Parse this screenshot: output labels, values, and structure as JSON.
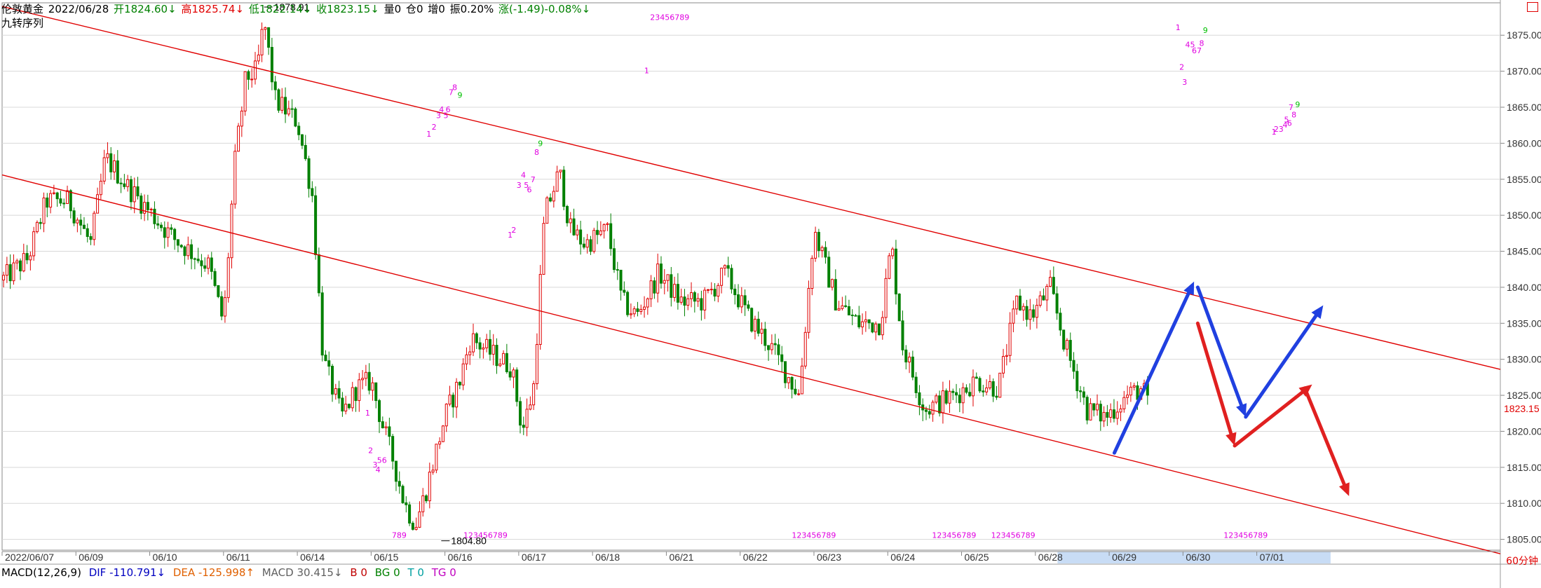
{
  "header": {
    "symbol": "伦敦黄金",
    "date": "2022/06/28",
    "open": "开1824.60↓",
    "high": "高1825.74↓",
    "low": "低1822.14↓",
    "close": "收1823.15↓",
    "volume": "量0",
    "position": "仓0",
    "increase": "增0",
    "amplitude": "振0.20%",
    "change": "涨(-1.49)-0.08%↓"
  },
  "indicator_title": "九转序列",
  "macd": {
    "name": "MACD(12,26,9)",
    "dif": "DIF -110.791↓",
    "dea": "DEA -125.998↑",
    "macd": "MACD 30.415↓",
    "b": "B 0",
    "bg": "BG 0",
    "t": "T 0",
    "tg": "TG 0"
  },
  "period_label": "60分钟",
  "current_price_label": "1823.15",
  "colors": {
    "up": "#e00000",
    "down": "#008000",
    "trendline": "#e00000",
    "arrow_blue": "#2040e0",
    "arrow_red": "#e02020",
    "seq": "#e000e0",
    "seq_green": "#00c000",
    "axis_hl": "#c8dcf5"
  },
  "chart_data": {
    "type": "candlestick",
    "y_axis": {
      "min": 1803.5,
      "max": 1879.5,
      "ticks": [
        1805,
        1810,
        1815,
        1820,
        1825,
        1830,
        1835,
        1840,
        1845,
        1850,
        1855,
        1860,
        1865,
        1870,
        1875
      ],
      "tick_labels": [
        "1805.00",
        "1810.00",
        "1815.00",
        "1820.00",
        "1825.00",
        "1830.00",
        "1835.00",
        "1840.00",
        "1845.00",
        "1850.00",
        "1855.00",
        "1860.00",
        "1865.00",
        "1870.00",
        "1875.00"
      ],
      "position": "right"
    },
    "x_axis": {
      "start": 0,
      "end": 20.3,
      "labels": [
        {
          "x": 0,
          "text": "2022/06/07"
        },
        {
          "x": 1,
          "text": "06/09"
        },
        {
          "x": 2,
          "text": "06/10"
        },
        {
          "x": 3,
          "text": "06/11"
        },
        {
          "x": 4,
          "text": "06/14"
        },
        {
          "x": 5,
          "text": "06/15"
        },
        {
          "x": 6,
          "text": "06/16"
        },
        {
          "x": 7,
          "text": "06/17"
        },
        {
          "x": 8,
          "text": "06/18"
        },
        {
          "x": 9,
          "text": "06/21"
        },
        {
          "x": 10,
          "text": "06/22"
        },
        {
          "x": 11,
          "text": "06/23"
        },
        {
          "x": 12,
          "text": "06/24"
        },
        {
          "x": 13,
          "text": "06/25"
        },
        {
          "x": 14,
          "text": "06/28"
        },
        {
          "x": 15,
          "text": "06/29"
        },
        {
          "x": 16,
          "text": "06/30"
        },
        {
          "x": 17,
          "text": "07/01"
        }
      ],
      "highlight": [
        14.3,
        18.0
      ]
    },
    "grid": true,
    "anchors": [
      [
        0.0,
        1841
      ],
      [
        0.35,
        1844
      ],
      [
        0.6,
        1852
      ],
      [
        0.9,
        1852
      ],
      [
        1.2,
        1846
      ],
      [
        1.4,
        1858
      ],
      [
        1.7,
        1854
      ],
      [
        2.3,
        1847
      ],
      [
        2.8,
        1843
      ],
      [
        3.0,
        1835
      ],
      [
        3.15,
        1857
      ],
      [
        3.3,
        1869
      ],
      [
        3.45,
        1870
      ],
      [
        3.55,
        1877
      ],
      [
        3.7,
        1866
      ],
      [
        4.0,
        1863
      ],
      [
        4.2,
        1853
      ],
      [
        4.35,
        1830
      ],
      [
        4.6,
        1822
      ],
      [
        4.8,
        1826
      ],
      [
        5.0,
        1827
      ],
      [
        5.15,
        1821
      ],
      [
        5.3,
        1816
      ],
      [
        5.45,
        1810
      ],
      [
        5.6,
        1807
      ],
      [
        5.75,
        1812
      ],
      [
        6.0,
        1822
      ],
      [
        6.2,
        1827
      ],
      [
        6.35,
        1833
      ],
      [
        6.6,
        1831
      ],
      [
        6.9,
        1829
      ],
      [
        7.05,
        1820
      ],
      [
        7.2,
        1826
      ],
      [
        7.35,
        1850
      ],
      [
        7.55,
        1856
      ],
      [
        7.7,
        1848
      ],
      [
        7.9,
        1846
      ],
      [
        8.2,
        1848
      ],
      [
        8.4,
        1838
      ],
      [
        8.6,
        1836
      ],
      [
        8.9,
        1842
      ],
      [
        9.2,
        1838
      ],
      [
        9.5,
        1838
      ],
      [
        9.8,
        1842
      ],
      [
        10.1,
        1836
      ],
      [
        10.4,
        1832
      ],
      [
        10.8,
        1825
      ],
      [
        11.0,
        1848
      ],
      [
        11.3,
        1838
      ],
      [
        11.6,
        1835
      ],
      [
        11.9,
        1835
      ],
      [
        12.05,
        1846
      ],
      [
        12.2,
        1832
      ],
      [
        12.5,
        1823
      ],
      [
        12.9,
        1825
      ],
      [
        13.2,
        1827
      ],
      [
        13.5,
        1826
      ],
      [
        13.75,
        1838
      ],
      [
        13.95,
        1836
      ],
      [
        14.2,
        1840
      ],
      [
        14.4,
        1832
      ],
      [
        14.7,
        1823
      ],
      [
        14.95,
        1822
      ],
      [
        15.25,
        1825
      ],
      [
        15.45,
        1826
      ],
      [
        15.55,
        1823
      ]
    ],
    "annotations": [
      {
        "x": 3.55,
        "y": 1878.91,
        "text": "1878.91",
        "type": "high"
      },
      {
        "x": 5.95,
        "y": 1804.8,
        "text": "1804.80",
        "type": "low"
      }
    ],
    "trendlines": [
      {
        "from": [
          0.0,
          1879.0
        ],
        "to": [
          20.3,
          1828.6
        ]
      },
      {
        "from": [
          0.0,
          1855.6
        ],
        "to": [
          20.3,
          1803.0
        ]
      }
    ],
    "arrows": [
      {
        "color": "blue",
        "from": [
          15.07,
          1817.0
        ],
        "to": [
          16.15,
          1840.8
        ]
      },
      {
        "color": "blue",
        "from": [
          16.2,
          1840.0
        ],
        "to": [
          16.85,
          1822.0
        ]
      },
      {
        "color": "blue",
        "from": [
          16.85,
          1822.0
        ],
        "to": [
          17.9,
          1837.5
        ]
      },
      {
        "color": "red",
        "from": [
          16.2,
          1835.0
        ],
        "to": [
          16.7,
          1818.0
        ]
      },
      {
        "color": "red",
        "from": [
          16.7,
          1818.0
        ],
        "to": [
          17.75,
          1826.5
        ]
      },
      {
        "color": "red",
        "from": [
          17.65,
          1826.0
        ],
        "to": [
          18.25,
          1811.0
        ]
      }
    ],
    "sequence_labels": [
      {
        "x": 4.92,
        "y": 1822.2,
        "text": "1"
      },
      {
        "x": 4.96,
        "y": 1817.0,
        "text": "2"
      },
      {
        "x": 5.02,
        "y": 1815.0,
        "text": "3"
      },
      {
        "x": 5.08,
        "y": 1815.6,
        "text": "56"
      },
      {
        "x": 5.06,
        "y": 1814.3,
        "text": "4"
      },
      {
        "x": 5.75,
        "y": 1860.9,
        "text": "1"
      },
      {
        "x": 5.82,
        "y": 1861.9,
        "text": "2"
      },
      {
        "x": 5.88,
        "y": 1863.5,
        "text": "3"
      },
      {
        "x": 5.92,
        "y": 1864.3,
        "text": "4"
      },
      {
        "x": 5.98,
        "y": 1863.5,
        "text": "5"
      },
      {
        "x": 6.01,
        "y": 1864.3,
        "text": "6"
      },
      {
        "x": 6.05,
        "y": 1866.7,
        "text": "7"
      },
      {
        "x": 6.1,
        "y": 1867.4,
        "text": "8"
      },
      {
        "x": 6.17,
        "y": 1866.3,
        "text": "9"
      },
      {
        "x": 6.85,
        "y": 1846.9,
        "text": "1"
      },
      {
        "x": 6.9,
        "y": 1847.6,
        "text": "2"
      },
      {
        "x": 6.97,
        "y": 1853.8,
        "text": "3"
      },
      {
        "x": 7.03,
        "y": 1855.2,
        "text": "4"
      },
      {
        "x": 7.07,
        "y": 1853.8,
        "text": "5"
      },
      {
        "x": 7.11,
        "y": 1853.2,
        "text": "6"
      },
      {
        "x": 7.16,
        "y": 1854.6,
        "text": "7"
      },
      {
        "x": 7.21,
        "y": 1858.4,
        "text": "8"
      },
      {
        "x": 7.26,
        "y": 1859.6,
        "text": "9"
      },
      {
        "x": 8.7,
        "y": 1869.7,
        "text": "1"
      },
      {
        "x": 8.78,
        "y": 1877.1,
        "text": "23456789"
      },
      {
        "x": 15.9,
        "y": 1875.7,
        "text": "1"
      },
      {
        "x": 15.95,
        "y": 1870.2,
        "text": "2"
      },
      {
        "x": 15.99,
        "y": 1868.1,
        "text": "3"
      },
      {
        "x": 16.03,
        "y": 1873.3,
        "text": "45"
      },
      {
        "x": 16.12,
        "y": 1872.5,
        "text": "67"
      },
      {
        "x": 16.22,
        "y": 1873.5,
        "text": "8"
      },
      {
        "x": 16.27,
        "y": 1875.3,
        "text": "9"
      },
      {
        "x": 17.2,
        "y": 1861.2,
        "text": "1"
      },
      {
        "x": 17.23,
        "y": 1861.6,
        "text": "23"
      },
      {
        "x": 17.35,
        "y": 1862.2,
        "text": "4"
      },
      {
        "x": 17.37,
        "y": 1862.9,
        "text": "5"
      },
      {
        "x": 17.41,
        "y": 1862.4,
        "text": "6"
      },
      {
        "x": 17.43,
        "y": 1864.6,
        "text": "7"
      },
      {
        "x": 17.47,
        "y": 1863.6,
        "text": "8"
      },
      {
        "x": 17.52,
        "y": 1865.0,
        "text": "9"
      },
      {
        "x": 5.28,
        "y": 1805.2,
        "text": "789"
      },
      {
        "x": 6.25,
        "y": 1805.2,
        "text": "123456789"
      },
      {
        "x": 10.7,
        "y": 1805.2,
        "text": "123456789"
      },
      {
        "x": 12.6,
        "y": 1805.2,
        "text": "123456789"
      },
      {
        "x": 13.4,
        "y": 1805.2,
        "text": "123456789"
      },
      {
        "x": 16.55,
        "y": 1805.2,
        "text": "123456789"
      }
    ],
    "current_price": 1823.15
  }
}
